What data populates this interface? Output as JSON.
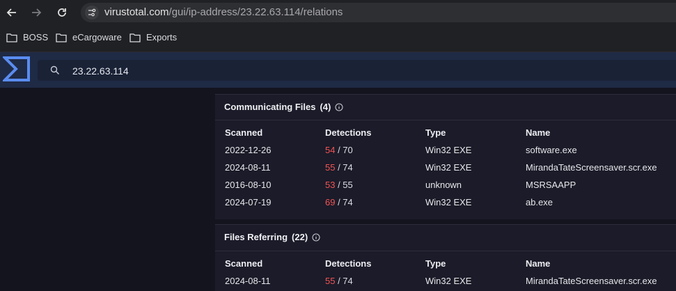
{
  "browser": {
    "url_host": "virustotal.com",
    "url_path": "/gui/ip-address/23.22.63.114/relations"
  },
  "bookmarks": [
    {
      "label": "BOSS"
    },
    {
      "label": "eCargoware"
    },
    {
      "label": "Exports"
    }
  ],
  "search": {
    "value": "23.22.63.114"
  },
  "communicating": {
    "title": "Communicating Files",
    "count": "(4)",
    "headers": {
      "scanned": "Scanned",
      "detections": "Detections",
      "type": "Type",
      "name": "Name"
    },
    "rows": [
      {
        "scanned": "2022-12-26",
        "det": "54",
        "total": " / 70",
        "type": "Win32 EXE",
        "name": "software.exe"
      },
      {
        "scanned": "2024-08-11",
        "det": "55",
        "total": " / 74",
        "type": "Win32 EXE",
        "name": "MirandaTateScreensaver.scr.exe"
      },
      {
        "scanned": "2016-08-10",
        "det": "53",
        "total": " / 55",
        "type": "unknown",
        "name": "MSRSAAPP"
      },
      {
        "scanned": "2024-07-19",
        "det": "69",
        "total": " / 74",
        "type": "Win32 EXE",
        "name": "ab.exe"
      }
    ]
  },
  "referring": {
    "title": "Files Referring",
    "count": "(22)",
    "headers": {
      "scanned": "Scanned",
      "detections": "Detections",
      "type": "Type",
      "name": "Name"
    },
    "rows": [
      {
        "scanned": "2024-08-11",
        "det": "55",
        "total": " / 74",
        "type": "Win32 EXE",
        "name": "MirandaTateScreensaver.scr.exe"
      }
    ]
  },
  "colors": {
    "detection": "#f05454",
    "header_bg": "#1f2a45",
    "page_bg": "#14141f"
  }
}
